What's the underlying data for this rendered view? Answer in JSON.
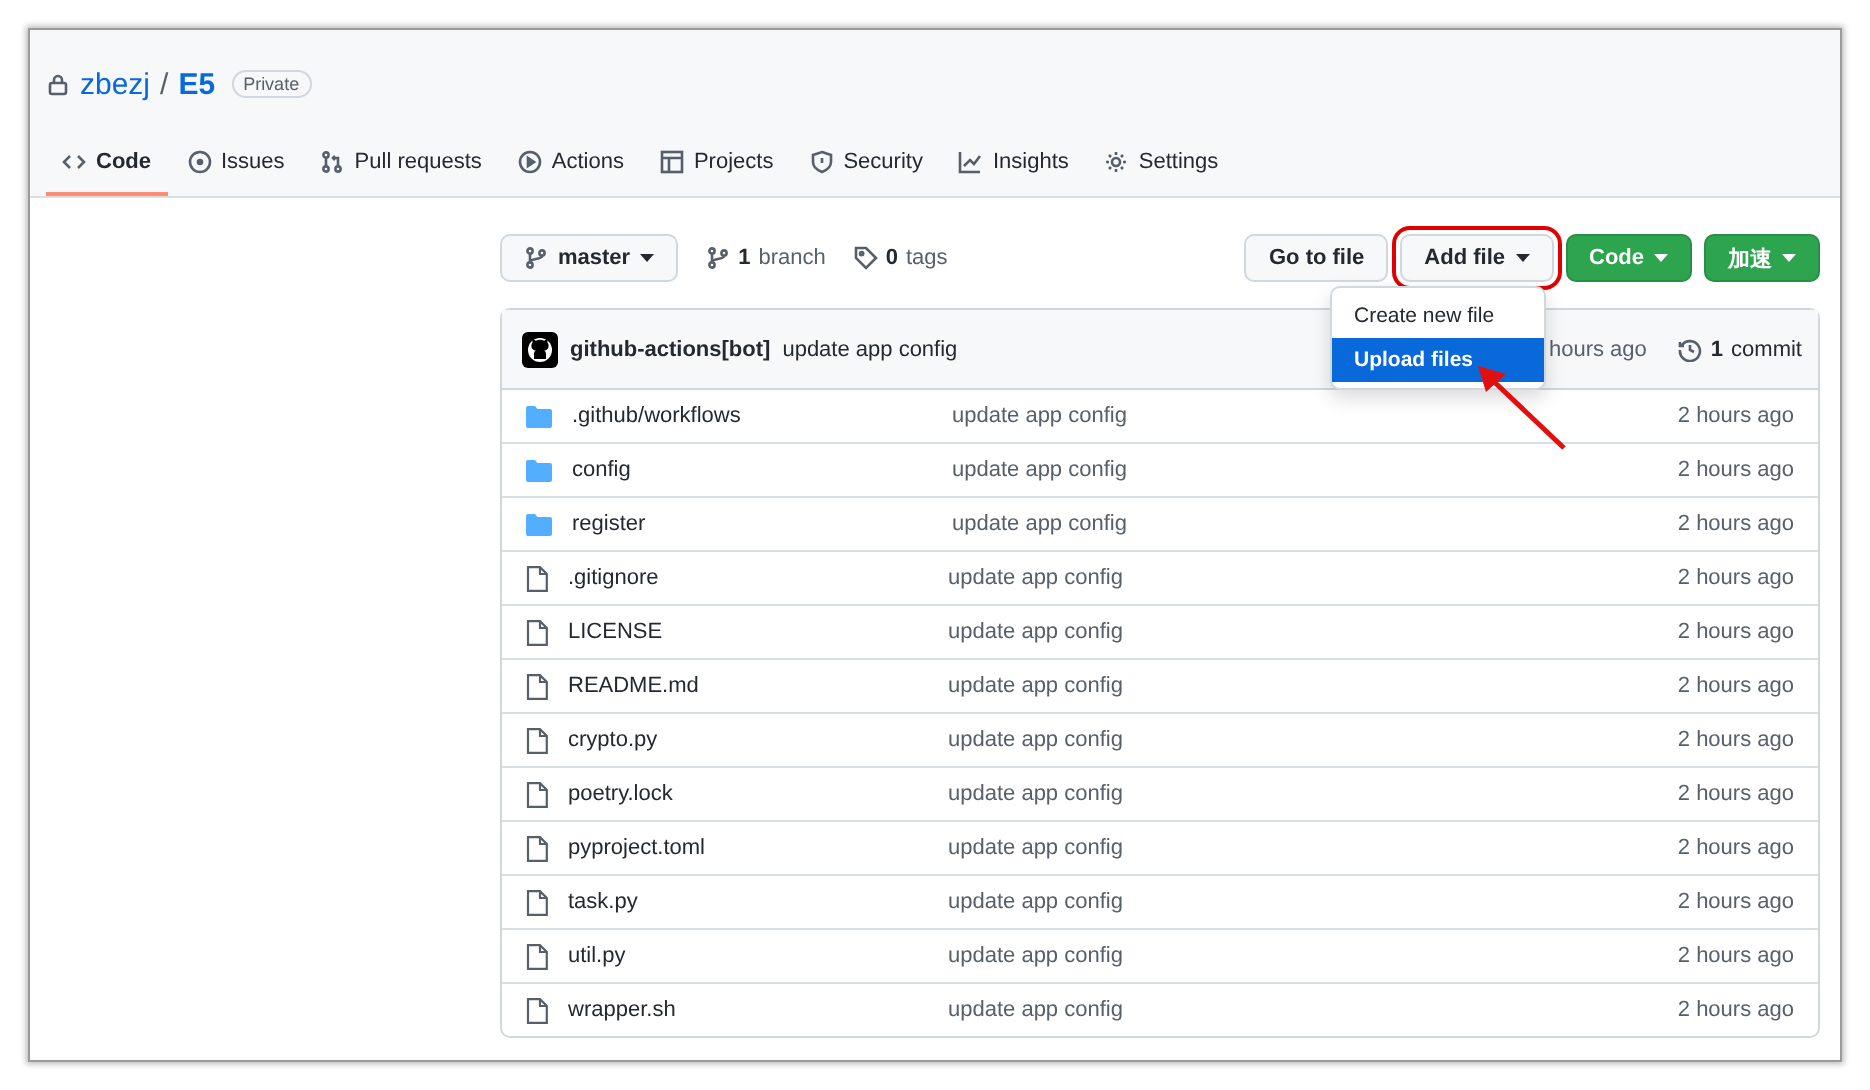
{
  "repo": {
    "owner": "zbezj",
    "separator": "/",
    "name": "E5",
    "visibility": "Private"
  },
  "tabs": [
    {
      "label": "Code",
      "selected": true
    },
    {
      "label": "Issues",
      "selected": false
    },
    {
      "label": "Pull requests",
      "selected": false
    },
    {
      "label": "Actions",
      "selected": false
    },
    {
      "label": "Projects",
      "selected": false
    },
    {
      "label": "Security",
      "selected": false
    },
    {
      "label": "Insights",
      "selected": false
    },
    {
      "label": "Settings",
      "selected": false
    }
  ],
  "toolbar": {
    "branch": "master",
    "branches": {
      "count": "1",
      "label": "branch"
    },
    "tags": {
      "count": "0",
      "label": "tags"
    },
    "buttons": [
      {
        "label": "Go to file",
        "kind": "default",
        "caret": false,
        "highlighted": false
      },
      {
        "label": "Add file",
        "kind": "default",
        "caret": true,
        "highlighted": true
      },
      {
        "label": "Code",
        "kind": "primary",
        "caret": true,
        "highlighted": false
      },
      {
        "label": "加速",
        "kind": "primary",
        "caret": true,
        "highlighted": false
      }
    ]
  },
  "latest_commit": {
    "author": "github-actions[bot]",
    "message": "update app config",
    "time": "hours ago",
    "commits": {
      "count": "1",
      "label": "commit"
    }
  },
  "dropdown": {
    "items": [
      {
        "label": "Create new file",
        "selected": false
      },
      {
        "label": "Upload files",
        "selected": true
      }
    ],
    "callout_arrow": true
  },
  "files": [
    {
      "kind": "dir",
      "name": ".github/workflows",
      "message": "update app config",
      "time": "2 hours ago"
    },
    {
      "kind": "dir",
      "name": "config",
      "message": "update app config",
      "time": "2 hours ago"
    },
    {
      "kind": "dir",
      "name": "register",
      "message": "update app config",
      "time": "2 hours ago"
    },
    {
      "kind": "file",
      "name": ".gitignore",
      "message": "update app config",
      "time": "2 hours ago"
    },
    {
      "kind": "file",
      "name": "LICENSE",
      "message": "update app config",
      "time": "2 hours ago"
    },
    {
      "kind": "file",
      "name": "README.md",
      "message": "update app config",
      "time": "2 hours ago"
    },
    {
      "kind": "file",
      "name": "crypto.py",
      "message": "update app config",
      "time": "2 hours ago"
    },
    {
      "kind": "file",
      "name": "poetry.lock",
      "message": "update app config",
      "time": "2 hours ago"
    },
    {
      "kind": "file",
      "name": "pyproject.toml",
      "message": "update app config",
      "time": "2 hours ago"
    },
    {
      "kind": "file",
      "name": "task.py",
      "message": "update app config",
      "time": "2 hours ago"
    },
    {
      "kind": "file",
      "name": "util.py",
      "message": "update app config",
      "time": "2 hours ago"
    },
    {
      "kind": "file",
      "name": "wrapper.sh",
      "message": "update app config",
      "time": "2 hours ago"
    }
  ]
}
